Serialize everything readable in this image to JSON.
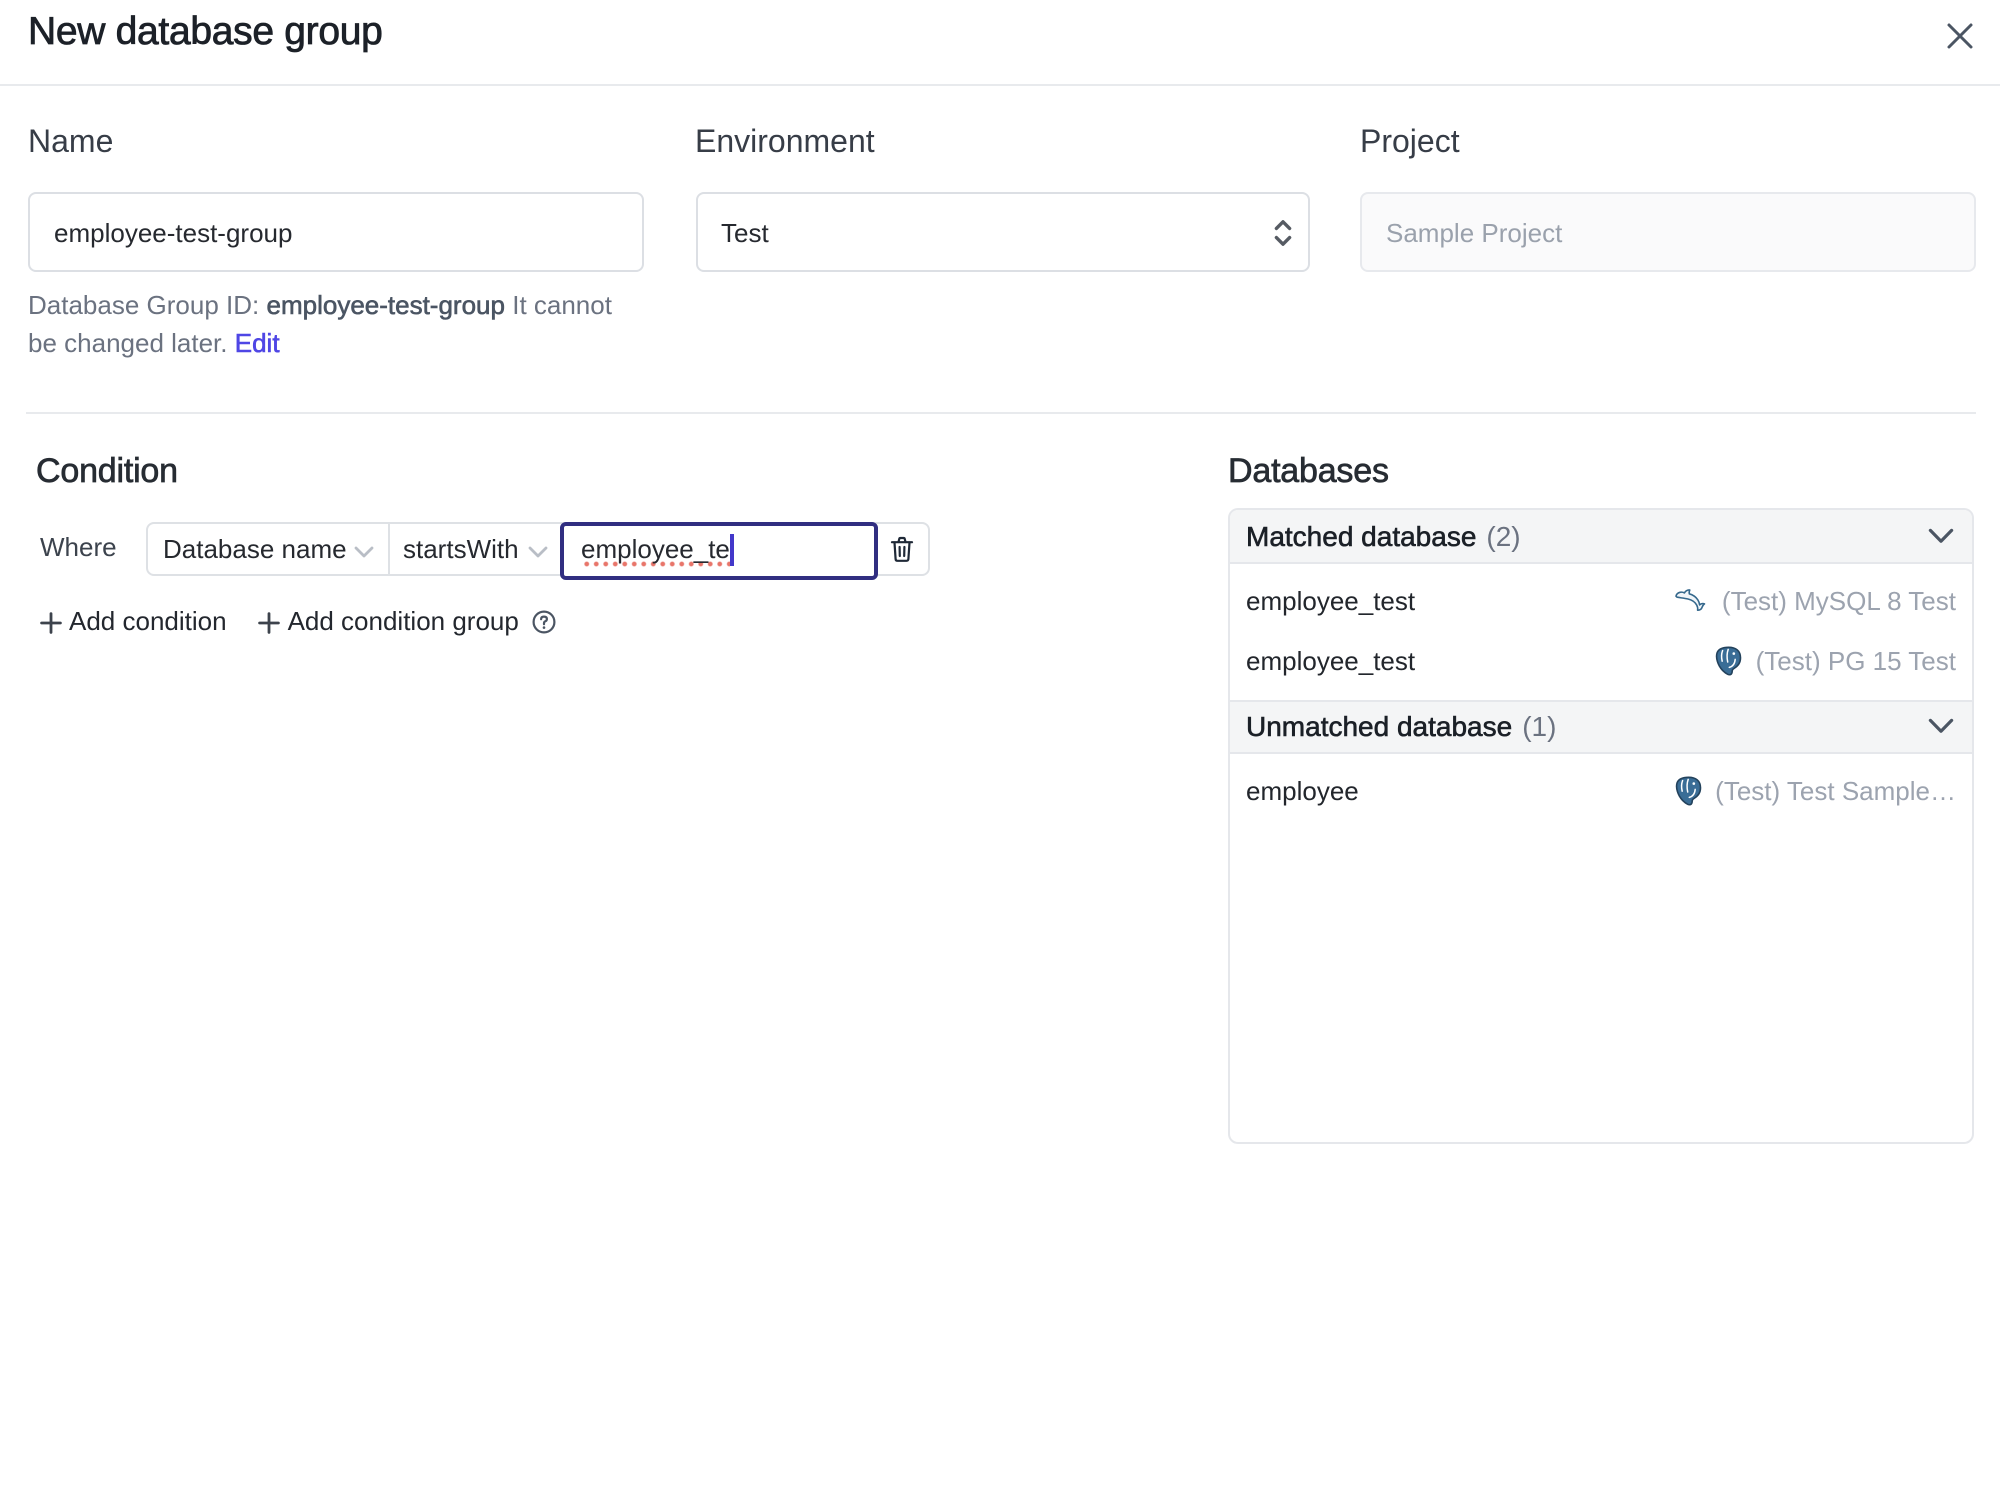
{
  "dialog": {
    "title": "New database group"
  },
  "form": {
    "name": {
      "label": "Name",
      "value": "employee-test-group"
    },
    "environment": {
      "label": "Environment",
      "value": "Test"
    },
    "project": {
      "label": "Project",
      "value": "Sample Project"
    },
    "id_hint": {
      "prefix": "Database Group ID:",
      "id": "employee-test-group",
      "suffix": "It cannot be changed later.",
      "edit_label": "Edit"
    }
  },
  "condition": {
    "heading": "Condition",
    "where_label": "Where",
    "factor": "Database name",
    "operator": "startsWith",
    "value": "employee_te",
    "add_condition_label": "Add condition",
    "add_condition_group_label": "Add condition group"
  },
  "databases": {
    "heading": "Databases",
    "groups": [
      {
        "title": "Matched database",
        "count": "(2)",
        "rows": [
          {
            "name": "employee_test",
            "engine_icon": "mysql-icon",
            "instance": "(Test) MySQL 8 Test"
          },
          {
            "name": "employee_test",
            "engine_icon": "postgresql-icon",
            "instance": "(Test) PG 15 Test"
          }
        ]
      },
      {
        "title": "Unmatched database",
        "count": "(1)",
        "rows": [
          {
            "name": "employee",
            "engine_icon": "postgresql-icon",
            "instance": "(Test) Test Sample…"
          }
        ]
      }
    ]
  },
  "colors": {
    "accent": "#4f46e5",
    "focus_border": "#312e81",
    "band_bg": "#f4f5f6",
    "border": "#e5e7eb",
    "muted_text": "#9ca3af",
    "spellcheck_underline": "#e8756a"
  }
}
